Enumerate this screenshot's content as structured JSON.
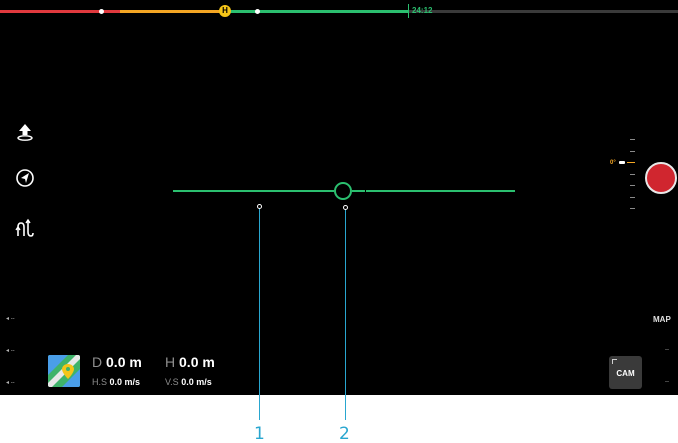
{
  "battery_bar": {
    "flight_time": "24:12",
    "home_marker": "H",
    "colors": {
      "critical": "#e0393e",
      "low": "#f5a623",
      "remaining": "#2bbf6f"
    }
  },
  "left_tools": [
    "takeoff-icon",
    "return-to-home-icon",
    "intelligent-flight-icon"
  ],
  "gimbal": {
    "pitch_label": "0°"
  },
  "left_indicators": [
    "--",
    "--",
    "--"
  ],
  "right_indicators": {
    "map_label": "MAP",
    "values": [
      "--",
      "--"
    ]
  },
  "telemetry": {
    "distance_key": "D",
    "distance_value": "0.0 m",
    "height_key": "H",
    "height_value": "0.0 m",
    "hspeed_key": "H.S",
    "hspeed_value": "0.0 m/s",
    "vspeed_key": "V.S",
    "vspeed_value": "0.0 m/s"
  },
  "camera_button": {
    "label": "CAM"
  },
  "callouts": [
    "1",
    "2"
  ],
  "colors": {
    "accent": "#2bbf6f",
    "callout": "#29a6cf",
    "shutter": "#d0262f"
  }
}
